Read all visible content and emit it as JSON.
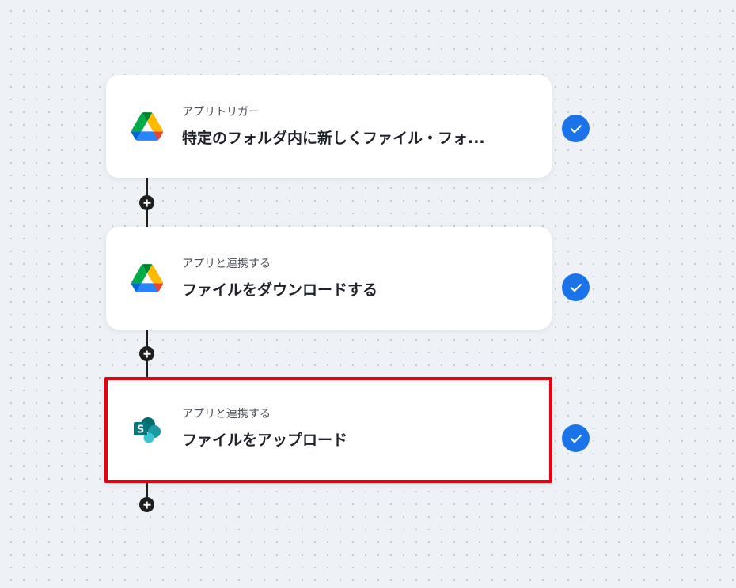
{
  "colors": {
    "canvas_background": "#eef1f5",
    "connector": "#1f1f1f",
    "check_badge": "#1a73e8",
    "highlight_border": "#e60012"
  },
  "steps": [
    {
      "kind": "アプリトリガー",
      "title": "特定のフォルダ内に新しくファイル・フォ...",
      "app_icon": "google-drive-icon",
      "status_icon": "check-circle-icon"
    },
    {
      "kind": "アプリと連携する",
      "title": "ファイルをダウンロードする",
      "app_icon": "google-drive-icon",
      "status_icon": "check-circle-icon"
    },
    {
      "kind": "アプリと連携する",
      "title": "ファイルをアップロード",
      "app_icon": "sharepoint-icon",
      "status_icon": "check-circle-icon",
      "highlighted": true
    }
  ],
  "add_step_icon": "plus-circle-icon"
}
